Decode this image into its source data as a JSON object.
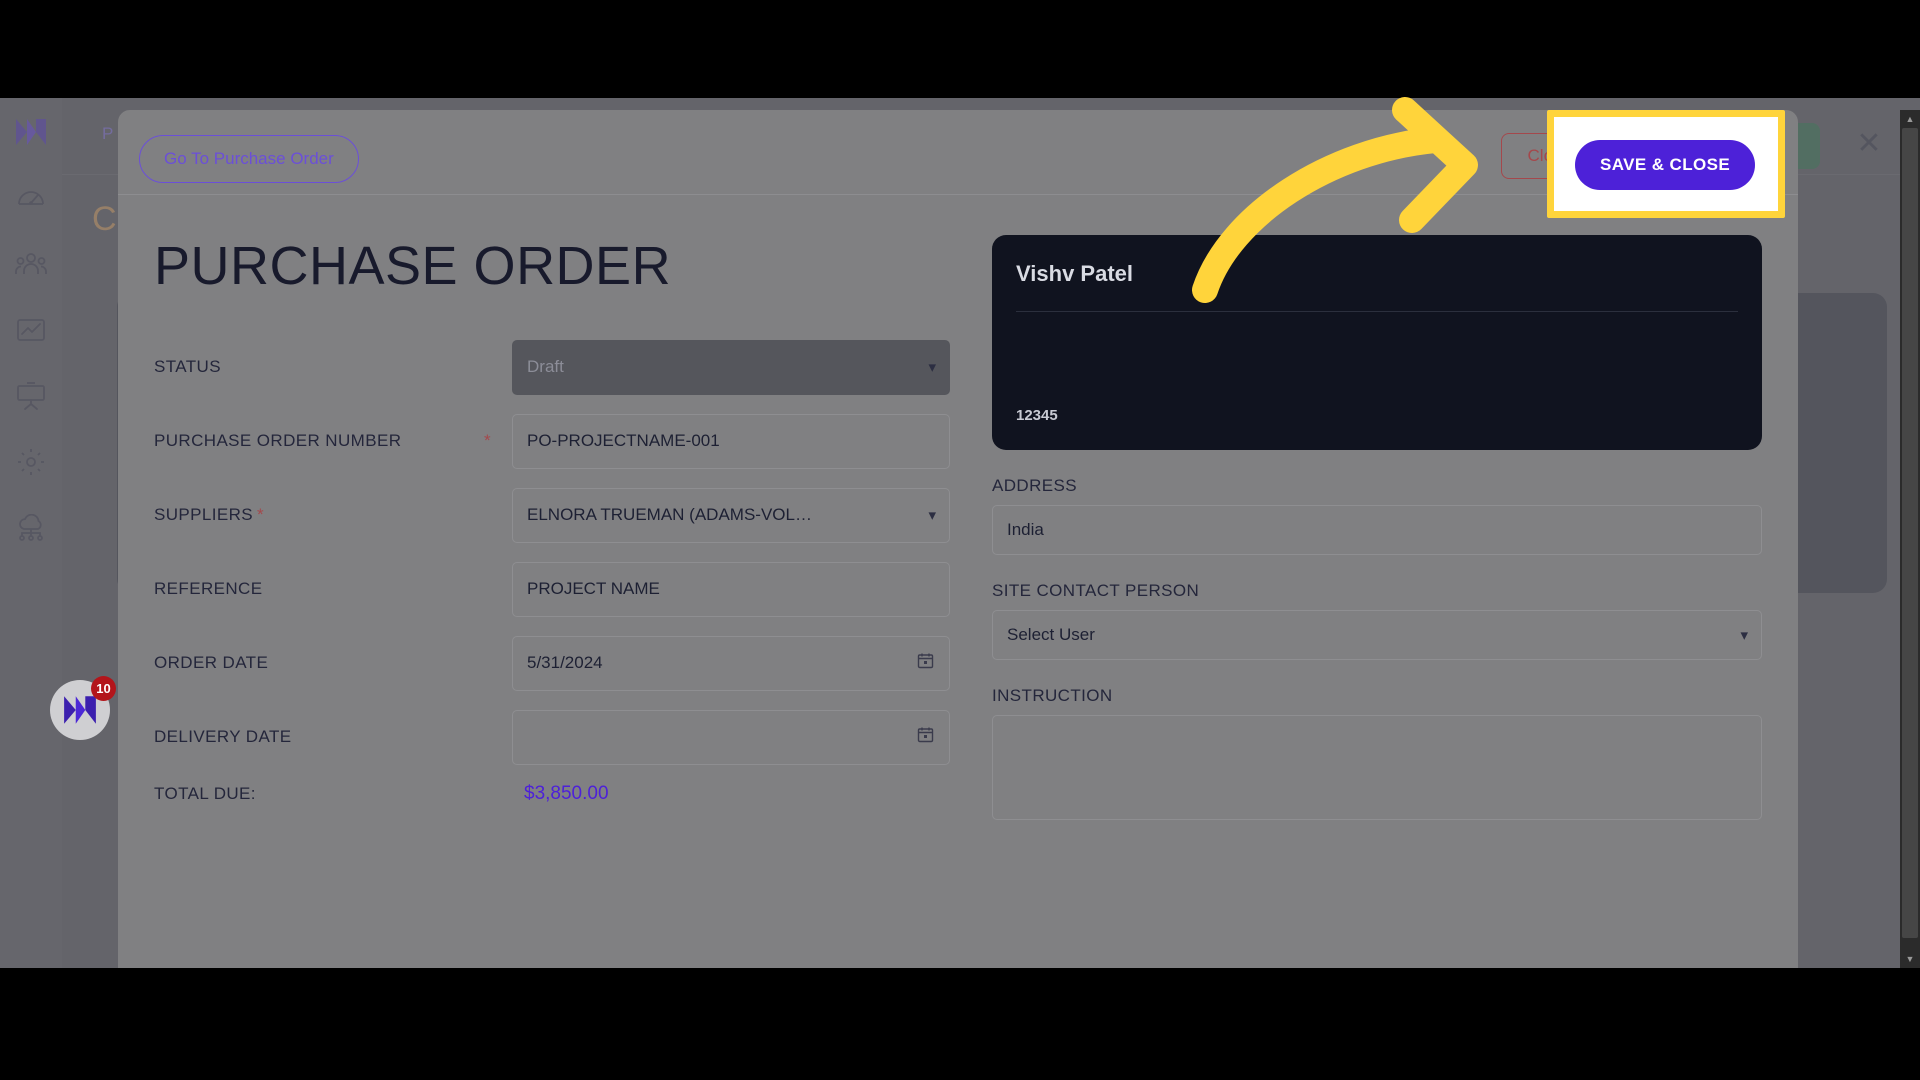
{
  "sidebar": {
    "items": [
      {
        "name": "logo",
        "icon": "brand-m-logo"
      },
      {
        "name": "dashboard",
        "icon": "speedometer-icon"
      },
      {
        "name": "team",
        "icon": "people-group-icon"
      },
      {
        "name": "analytics",
        "icon": "line-chart-icon"
      },
      {
        "name": "presentation",
        "icon": "presentation-board-icon"
      },
      {
        "name": "settings",
        "icon": "gear-icon"
      },
      {
        "name": "cloud",
        "icon": "cloud-network-icon"
      }
    ],
    "expander_glyph": "›"
  },
  "chat_bubble": {
    "badge_count": "10",
    "icon": "brand-m-logo"
  },
  "background": {
    "breadcrumb": "P",
    "title": "C",
    "close_icon": "✕"
  },
  "modal": {
    "header": {
      "go_to_purchase_order": "Go To Purchase Order",
      "close": "Close",
      "save_and_close": "SAVE & CLOSE"
    },
    "title": "PURCHASE ORDER",
    "fields": [
      {
        "label": "STATUS",
        "required": false,
        "type": "select",
        "value": "Draft",
        "disabled": true
      },
      {
        "label": "PURCHASE ORDER NUMBER",
        "required": true,
        "required_marker": "*",
        "type": "text",
        "value": "PO-PROJECTNAME-001"
      },
      {
        "label": "SUPPLIERS",
        "required": true,
        "required_marker": "*",
        "inline_marker": true,
        "type": "select",
        "value": "ELNORA TRUEMAN (ADAMS-VOL…"
      },
      {
        "label": "REFERENCE",
        "required": false,
        "type": "text",
        "value": "PROJECT NAME"
      },
      {
        "label": "ORDER DATE",
        "required": false,
        "type": "date",
        "value": "5/31/2024"
      },
      {
        "label": "DELIVERY DATE",
        "required": false,
        "type": "date",
        "value": ""
      }
    ],
    "total": {
      "label": "TOTAL DUE:",
      "value": "$3,850.00"
    },
    "supplier_card": {
      "name": "Vishv Patel",
      "number": "12345"
    },
    "right_fields": [
      {
        "label": "ADDRESS",
        "type": "text",
        "value": "India"
      },
      {
        "label": "SITE CONTACT PERSON",
        "type": "select",
        "value": "Select User"
      },
      {
        "label": "INSTRUCTION",
        "type": "textarea",
        "value": ""
      }
    ]
  },
  "annotation": {
    "arrow": "curved-arrow-right",
    "highlight_target": "SAVE & CLOSE"
  },
  "colors": {
    "accent_purple": "#4d21d8",
    "link_purple": "#6b4fd8",
    "danger_red": "#a4484c",
    "highlight_yellow": "#ffd43b",
    "card_dark": "#10131f"
  }
}
